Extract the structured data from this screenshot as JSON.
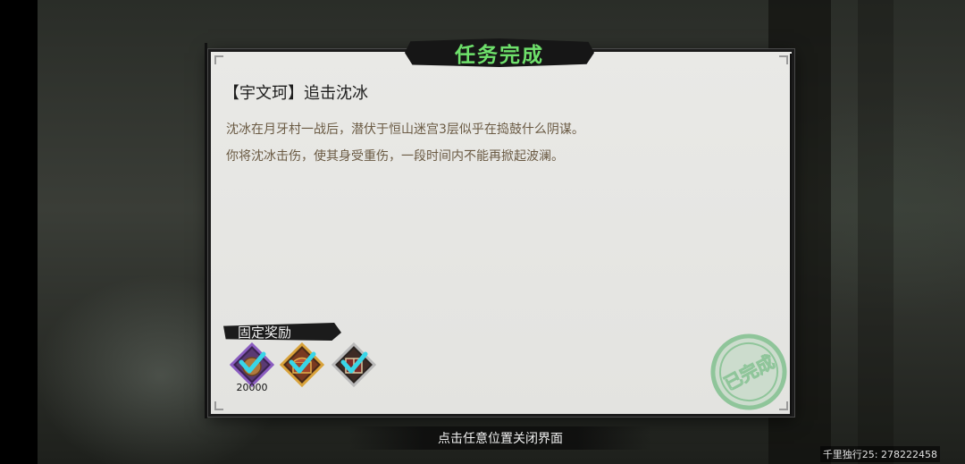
{
  "dialog": {
    "title": "任务完成",
    "quest_name": "【宇文珂】追击沈冰",
    "description_lines": [
      "沈冰在月牙村一战后，潜伏于恒山迷宫3层似乎在捣鼓什么阴谋。",
      "你将沈冰击伤，使其身受重伤，一段时间内不能再掀起波澜。"
    ],
    "rewards": {
      "title": "固定奖励",
      "items": [
        {
          "icon": "coin-pouch-icon",
          "count": "20000",
          "claimed": true,
          "frame_color": "#8a5cc0"
        },
        {
          "icon": "treasure-chest-icon",
          "count": "",
          "claimed": true,
          "frame_color": "#d8a23a"
        },
        {
          "icon": "scroll-book-icon",
          "count": "",
          "claimed": true,
          "frame_color": "#b9b9b9"
        }
      ]
    },
    "stamp_text": "已完成",
    "close_hint": "点击任意位置关闭界面"
  },
  "watermark": "千里独行25: 278222458",
  "colors": {
    "title_green": "#6ee06b",
    "check_cyan": "#39d6e8",
    "stamp_green": "#8fc59a",
    "description_brown": "#6a5a43"
  }
}
